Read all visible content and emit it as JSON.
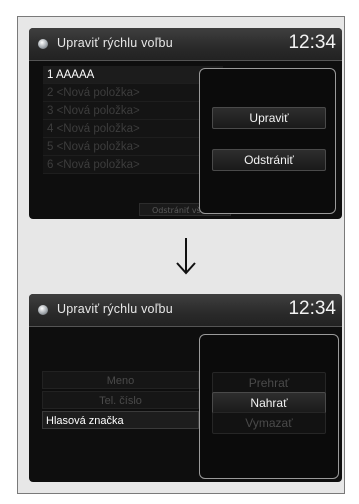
{
  "screen1": {
    "title": "Upraviť rýchlu voľbu",
    "clock": "12:34",
    "list": [
      {
        "label": "1  AAAAA",
        "active": true
      },
      {
        "label": "2  <Nová položka>",
        "active": false
      },
      {
        "label": "3  <Nová položka>",
        "active": false
      },
      {
        "label": "4  <Nová položka>",
        "active": false
      },
      {
        "label": "5  <Nová položka>",
        "active": false
      },
      {
        "label": "6  <Nová položka>",
        "active": false
      }
    ],
    "dialog": {
      "edit": "Upraviť",
      "delete": "Odstrániť"
    },
    "footer_button": "Odstrániť všetko"
  },
  "screen2": {
    "title": "Upraviť rýchlu voľbu",
    "clock": "12:34",
    "fields": {
      "name": "Meno",
      "phone": "Tel. číslo",
      "voice_tag": "Hlasová značka"
    },
    "dialog": {
      "play": "Prehrať",
      "record": "Nahrať",
      "delete": "Vymazať"
    }
  },
  "icons": {
    "title": "speed-dial-icon",
    "arrow": "arrow-down-icon"
  }
}
